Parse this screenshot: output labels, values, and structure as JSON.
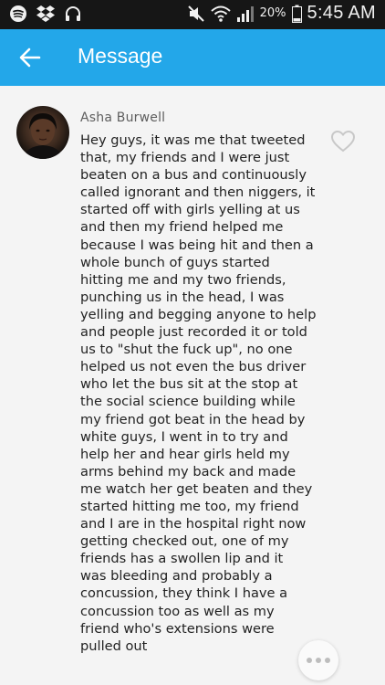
{
  "status_bar": {
    "battery_percent": "20%",
    "time": "5:45 AM",
    "icons": [
      "spotify-icon",
      "dropbox-icon",
      "headphones-icon",
      "mute-icon",
      "wifi-icon",
      "signal-icon",
      "battery-icon"
    ]
  },
  "app_bar": {
    "title": "Message",
    "back_icon": "arrow-left-icon",
    "color": "#23a7e9"
  },
  "message": {
    "sender": "Asha Burwell",
    "text": "Hey guys, it was me that tweeted\nthat, my friends and I were just\nbeaten on a bus and continuously\ncalled ignorant and then niggers, it\nstarted off with girls yelling at us\nand then my friend helped me\nbecause I was being hit and then a\nwhole bunch of guys started\nhitting me and my two friends,\npunching us in the head, I was\nyelling and begging anyone to help\nand people just recorded it or told\nus to \"shut the fuck up\", no one\nhelped us not even the bus driver\nwho let the bus sit at the stop at\nthe social science building while\nmy friend got beat in the head by\nwhite guys, I went in to try and\nhelp her and hear girls held my\narms behind my back and made\nme watch her get beaten and they\nstarted hitting me too, my friend\nand I are in the hospital right now\ngetting checked out, one of my\nfriends  has a swollen lip and it\nwas bleeding and probably a\nconcussion, they think I have a\nconcussion too as well as my\nfriend who's extensions were\npulled out",
    "like_icon": "heart-outline-icon",
    "more_icon": "more-horizontal-icon"
  }
}
